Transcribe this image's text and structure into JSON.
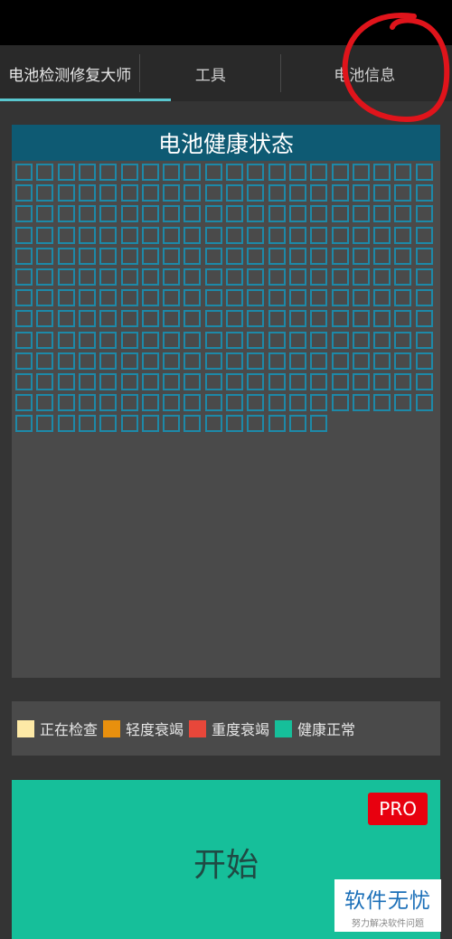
{
  "tabs": [
    {
      "label": "电池检测修复大师",
      "selected": true
    },
    {
      "label": "工具",
      "selected": false
    },
    {
      "label": "电池信息",
      "selected": false
    }
  ],
  "panel": {
    "title": "电池健康状态",
    "cells_checked": 255
  },
  "legend": [
    {
      "label": "正在检查",
      "color": "#fde9a6"
    },
    {
      "label": "轻度衰竭",
      "color": "#e8900e"
    },
    {
      "label": "重度衰竭",
      "color": "#e8473a"
    },
    {
      "label": "健康正常",
      "color": "#16bf9a"
    }
  ],
  "start": {
    "label": "开始",
    "badge": "PRO"
  },
  "colors": {
    "accent": "#59c7cf",
    "cell_border": "#1d89a8",
    "title_bar": "#0e5a73",
    "start_button": "#16bf9a",
    "pro_badge": "#e8000f",
    "annotation_circle": "#e0141b"
  },
  "watermark": {
    "title": "软件无忧",
    "subtitle": "努力解决软件问题"
  }
}
